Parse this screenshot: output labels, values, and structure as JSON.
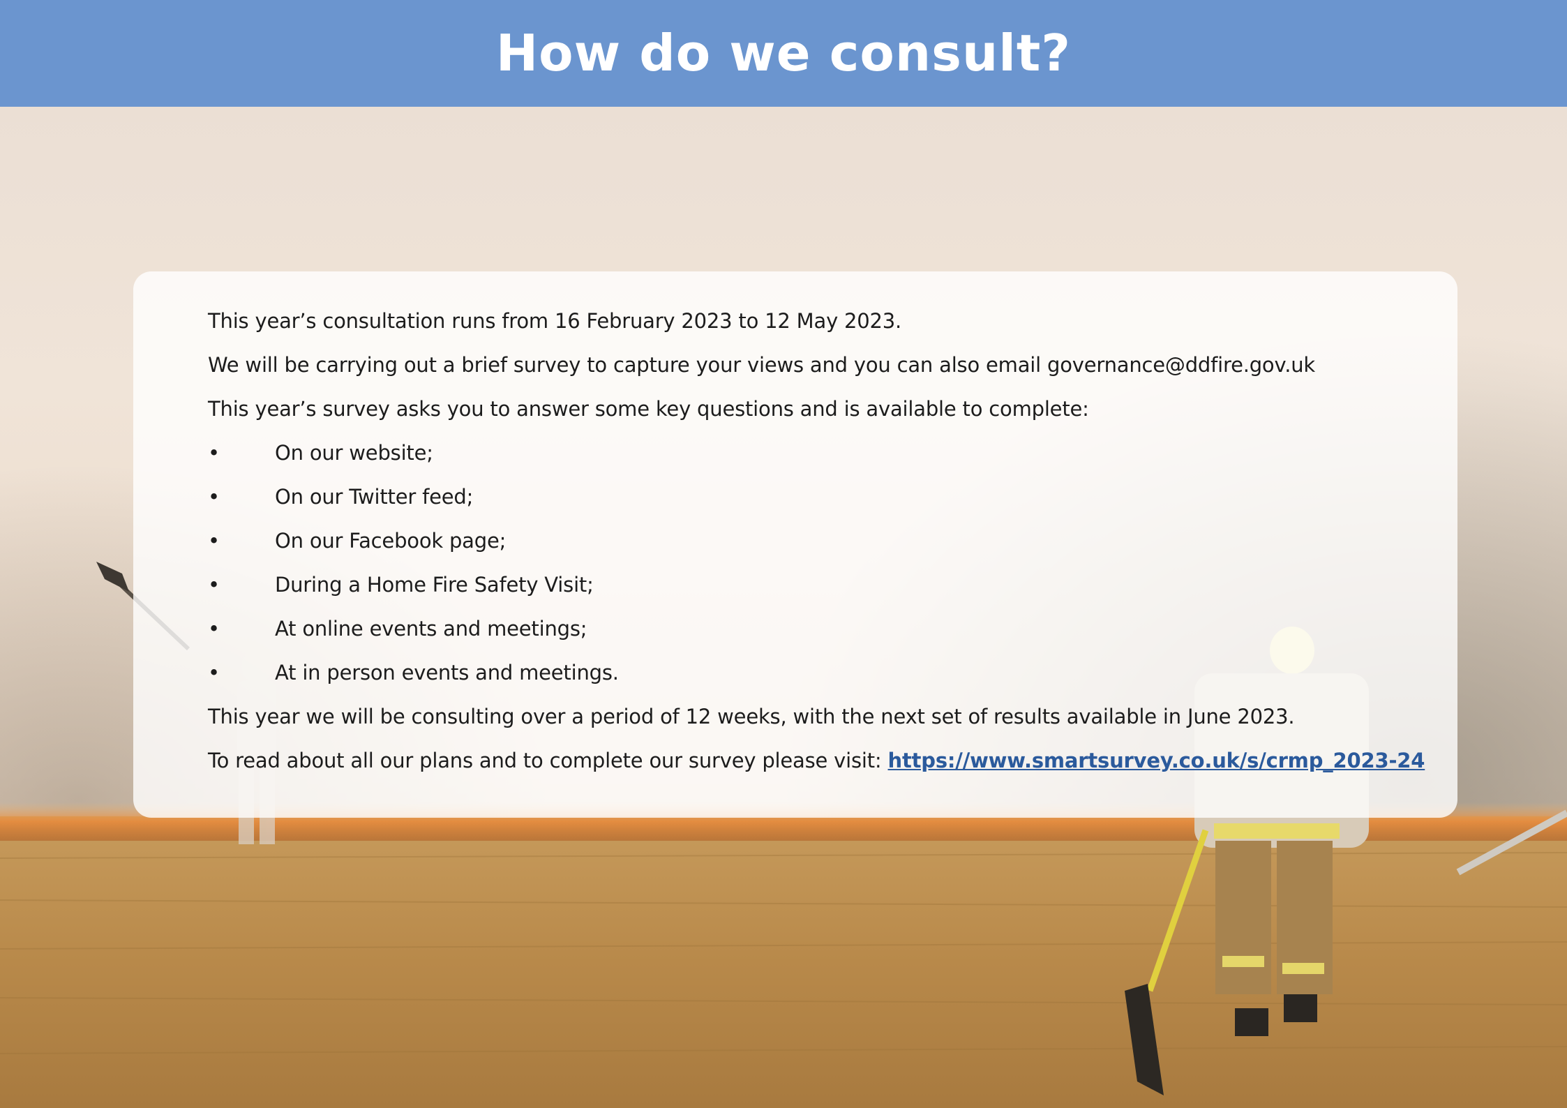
{
  "header": {
    "title": "How do we consult?"
  },
  "body": {
    "intro_lines": [
      "This year’s consultation runs from 16 February 2023 to 12 May 2023.",
      "We will be carrying out a brief survey to capture your views and you can also email governance@ddfire.gov.uk",
      "This year’s survey asks you to answer some key questions and is available to complete:"
    ],
    "bullet_symbol": "•",
    "bullets": [
      "On our website;",
      "On our Twitter feed;",
      "On our Facebook page;",
      "During a Home Fire Safety Visit;",
      "At online events and meetings;",
      "At in person events and meetings."
    ],
    "closing_line": "This year we will be consulting over a period of 12 weeks, with the next set of results available in June 2023.",
    "visit_prefix": "To read about all our plans and to complete our survey please visit: ",
    "visit_link": "https://www.smartsurvey.co.uk/s/crmp_2023-24"
  },
  "colors": {
    "header_band": "#6b95cf",
    "link": "#2b5a9c"
  }
}
